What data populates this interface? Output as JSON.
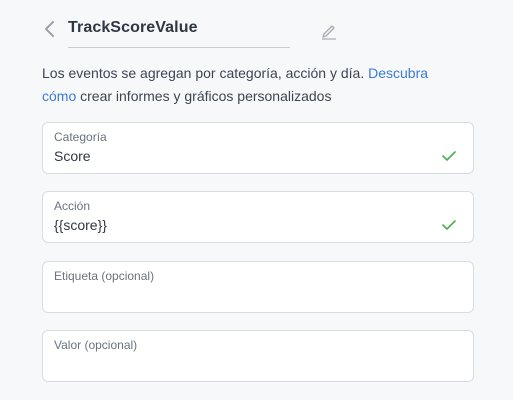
{
  "header": {
    "name": "TrackScoreValue",
    "back_icon": "chevron-left-icon",
    "edit_icon": "pencil-icon"
  },
  "help": {
    "text_before": "Los eventos se agregan por categoría, acción y día. ",
    "link_part1": "Descubra",
    "link_part2": "cómo",
    "text_after": " crear informes y gráficos personalizados"
  },
  "fields": {
    "category": {
      "label": "Categoría",
      "value": "Score"
    },
    "action": {
      "label": "Acción",
      "value": "{{score}}"
    },
    "tag": {
      "label": "Etiqueta (opcional)",
      "value": ""
    },
    "value": {
      "label": "Valor (opcional)",
      "value": ""
    }
  },
  "colors": {
    "accent": "#3a7ad6",
    "valid": "#4caf50",
    "background": "#f7f8fa"
  }
}
